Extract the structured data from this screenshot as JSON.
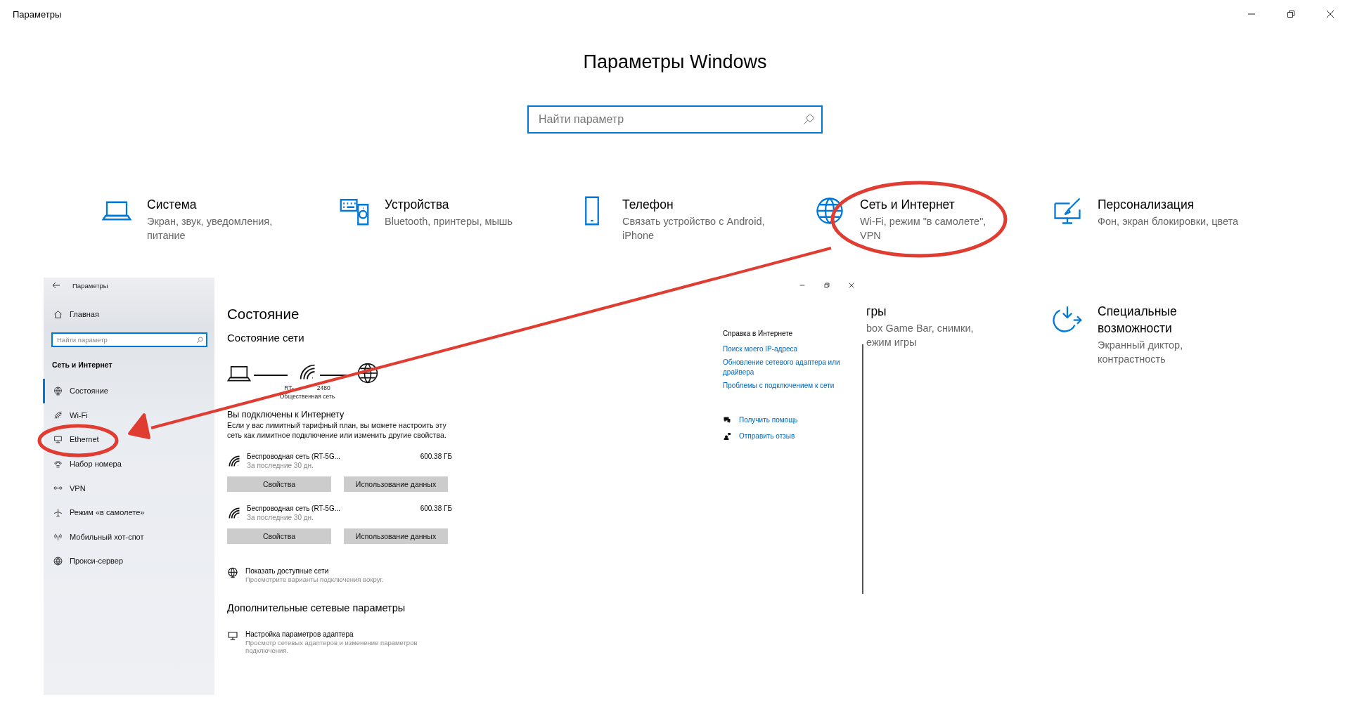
{
  "window": {
    "title": "Параметры"
  },
  "heading": "Параметры Windows",
  "search": {
    "placeholder": "Найти параметр"
  },
  "category_rows": [
    [
      {
        "kind": "laptop",
        "title": "Система",
        "description": "Экран, звук, уведомления,\nпитание"
      },
      {
        "kind": "devices",
        "title": "Устройства",
        "description": "Bluetooth, принтеры, мышь"
      },
      {
        "kind": "phone",
        "title": "Телефон",
        "description": "Связать устройство с Android,\niPhone"
      },
      {
        "kind": "globe",
        "title": "Сеть и Интернет",
        "description": "Wi-Fi, режим \"в самолете\",\nVPN"
      },
      {
        "kind": "personalization",
        "title": "Персонализация",
        "description": "Фон, экран блокировки, цвета"
      }
    ],
    [
      {
        "kind": "none",
        "title": "гры",
        "description": "box Game Bar, снимки,\nежим игры"
      },
      {
        "kind": "accessibility",
        "title": "Специальные\nвозможности",
        "description": "Экранный диктор,\nконтрастность"
      }
    ]
  ],
  "settings_window": {
    "title": "Параметры",
    "home": "Главная",
    "search": {
      "placeholder": "Найти параметр"
    },
    "section": "Сеть и Интернет",
    "nav": [
      {
        "label": "Состояние",
        "kind": "status",
        "selected": true
      },
      {
        "label": "Wi-Fi",
        "kind": "wifi",
        "selected": false
      },
      {
        "label": "Ethernet",
        "kind": "ethernet",
        "selected": false
      },
      {
        "label": "Набор номера",
        "kind": "dialup",
        "selected": false
      },
      {
        "label": "VPN",
        "kind": "vpn",
        "selected": false
      },
      {
        "label": "Режим «в самолете»",
        "kind": "airplane",
        "selected": false
      },
      {
        "label": "Мобильный хот-спот",
        "kind": "hotspot",
        "selected": false
      },
      {
        "label": "Прокси-сервер",
        "kind": "globe",
        "selected": false
      }
    ],
    "page_title": "Состояние",
    "network_status": {
      "heading": "Состояние сети",
      "network_name_visible_parts": [
        "RT-",
        "2480"
      ],
      "network_type": "Общественная сеть"
    },
    "connected": {
      "heading": "Вы подключены к Интернету",
      "text": "Если у вас лимитный тарифный план, вы можете настроить эту сеть как лимитное подключение или изменить другие свойства."
    },
    "connections": [
      {
        "name": "Беспроводная сеть (RT-5G...",
        "period": "За последние 30 дн.",
        "usage": "600.38 ГБ",
        "buttons": [
          "Свойства",
          "Использование данных"
        ]
      },
      {
        "name": "Беспроводная сеть (RT-5G...",
        "period": "За последние 30 дн.",
        "usage": "600.38 ГБ",
        "buttons": [
          "Свойства",
          "Использование данных"
        ]
      }
    ],
    "show_networks": {
      "title": "Показать доступные сети",
      "text": "Просмотрите варианты подключения вокруг."
    },
    "advanced": {
      "heading": "Дополнительные сетевые параметры",
      "items": [
        {
          "title": "Настройка параметров адаптера",
          "text": "Просмотр сетевых адаптеров и изменение параметров подключения."
        }
      ]
    },
    "help": {
      "heading": "Справка в Интернете",
      "links": [
        "Поиск моего IP-адреса",
        "Обновление сетевого адаптера или драйвера",
        "Проблемы с подключением к сети"
      ]
    },
    "actions": [
      {
        "label": "Получить помощь",
        "kind": "help"
      },
      {
        "label": "Отправить отзыв",
        "kind": "feedback"
      }
    ]
  }
}
